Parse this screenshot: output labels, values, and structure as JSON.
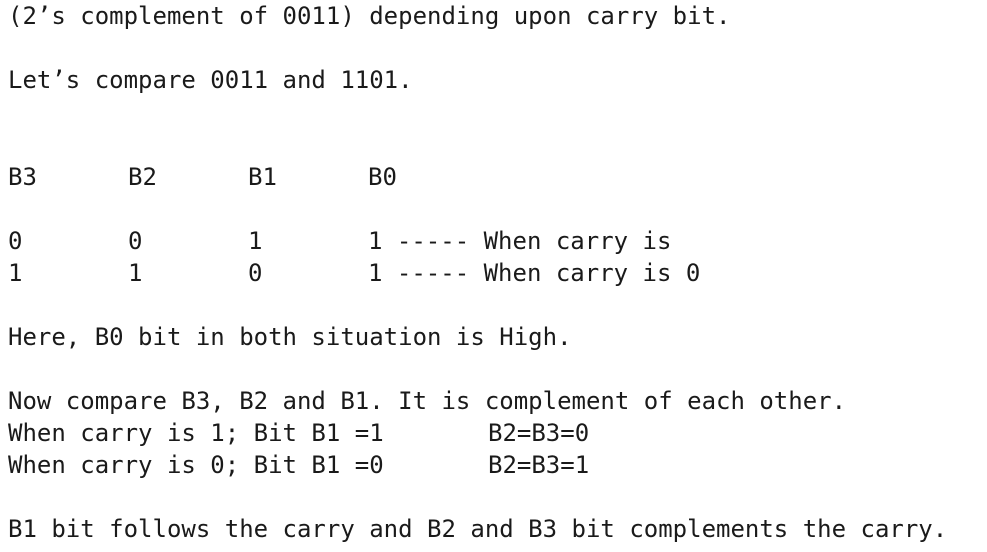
{
  "document": {
    "line1": "(2’s complement of 0011) depending upon carry bit.",
    "line2": "Let’s compare 0011 and 1101.",
    "table": {
      "headers": [
        "B3",
        "B2",
        "B1",
        "B0"
      ],
      "rows": [
        {
          "b3": "0",
          "b2": "0",
          "b1": "1",
          "b0": "1 ----- When carry is"
        },
        {
          "b3": "1",
          "b2": "1",
          "b1": "0",
          "b0": "1 ----- When carry is 0"
        }
      ]
    },
    "line3": "Here, B0 bit in both situation is High.",
    "line4": "Now compare B3, B2 and B1. It is complement of each other.",
    "cond1": {
      "left": "When carry is 1; Bit B1 =1",
      "right": "B2=B3=0"
    },
    "cond2": {
      "left": "When carry is 0; Bit B1 =0",
      "right": "B2=B3=1"
    },
    "line5": "B1 bit follows the carry and B2 and B3 bit complements the carry."
  }
}
